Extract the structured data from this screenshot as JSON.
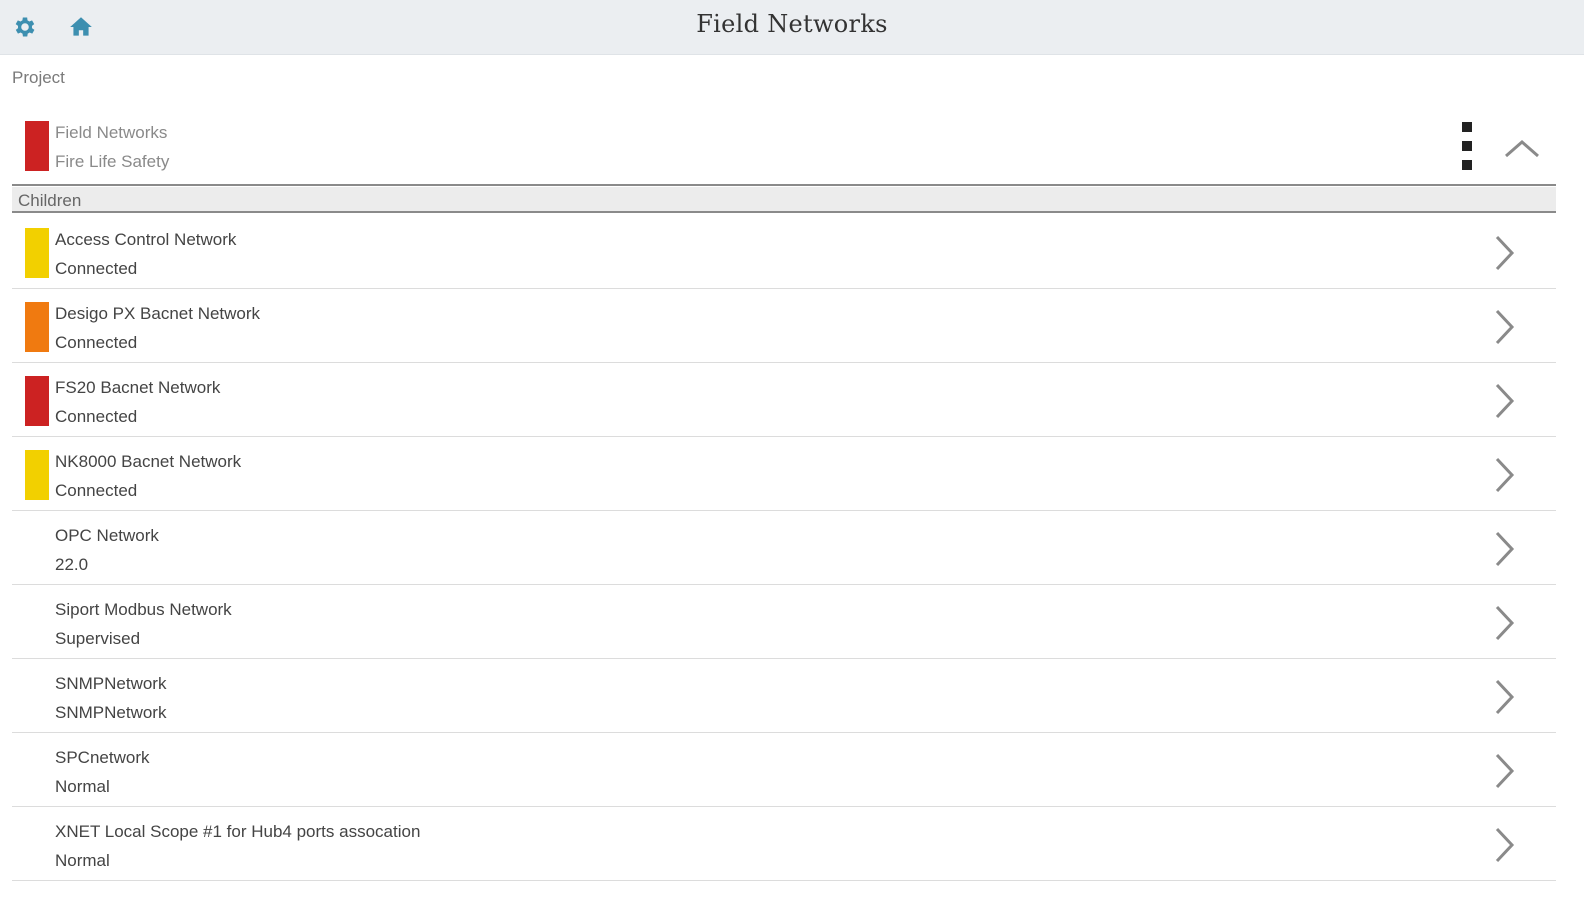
{
  "header": {
    "title": "Field Networks",
    "settings_icon": "gear-icon",
    "home_icon": "home-icon",
    "icon_color": "#3d8fb0"
  },
  "breadcrumb": "Project",
  "current": {
    "name": "Field Networks",
    "status": "Fire Life Safety",
    "color": "#cc2222",
    "menu_icon": "kebab-menu-icon",
    "collapse_icon": "chevron-up-icon"
  },
  "section_label": "Children",
  "children": [
    {
      "name": "Access Control Network",
      "status": "Connected",
      "color": "#f2d000"
    },
    {
      "name": "Desigo PX Bacnet Network",
      "status": "Connected",
      "color": "#f07a10"
    },
    {
      "name": "FS20 Bacnet Network",
      "status": "Connected",
      "color": "#cc2222"
    },
    {
      "name": "NK8000 Bacnet Network",
      "status": "Connected",
      "color": "#f2d000"
    },
    {
      "name": "OPC Network",
      "status": "22.0",
      "color": ""
    },
    {
      "name": "Siport Modbus Network",
      "status": "Supervised",
      "color": ""
    },
    {
      "name": "SNMPNetwork",
      "status": "SNMPNetwork",
      "color": ""
    },
    {
      "name": "SPCnetwork",
      "status": "Normal",
      "color": ""
    },
    {
      "name": "XNET Local Scope #1 for Hub4 ports assocation",
      "status": "Normal",
      "color": ""
    }
  ]
}
